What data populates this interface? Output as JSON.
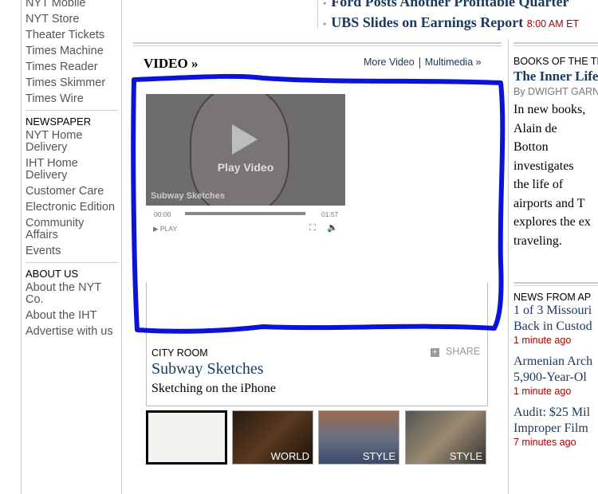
{
  "nav": {
    "items_top": [
      "NYT Mobile",
      "NYT Store",
      "Theater Tickets",
      "Times Machine",
      "Times Reader",
      "Times Skimmer",
      "Times Wire"
    ],
    "newspaper": {
      "heading": "NEWSPAPER",
      "items": [
        "NYT Home Delivery",
        "IHT Home Delivery",
        "Customer Care",
        "Electronic Edition",
        "Community Affairs",
        "Events"
      ]
    },
    "about": {
      "heading": "ABOUT US",
      "items": [
        "About the NYT Co.",
        "About the IHT",
        "Advertise with us"
      ]
    }
  },
  "headlines": [
    {
      "title": "Ford Posts Another Profitable Quarter",
      "time": ""
    },
    {
      "title": "UBS Slides on Earnings Report",
      "time": "8:00 AM ET"
    }
  ],
  "video": {
    "section_title": "VIDEO »",
    "more_video": "More Video",
    "multimedia": "Multimedia »",
    "player": {
      "play_label": "Play Video",
      "video_name": "Subway Sketches",
      "current_time": "00:00",
      "duration": "01:57",
      "play_button": "PLAY",
      "progress": 0
    },
    "category": "CITY ROOM",
    "share": "SHARE",
    "title": "Subway Sketches",
    "subtitle": "Sketching on the iPhone",
    "thumbs": [
      {
        "label": ""
      },
      {
        "label": "WORLD"
      },
      {
        "label": "STYLE"
      },
      {
        "label": "STYLE"
      }
    ]
  },
  "books": {
    "heading": "BOOKS OF THE TIMES",
    "title": "The Inner Life of Airports and",
    "byline": "By DWIGHT GARNER",
    "body": [
      "In new books,",
      "Alain de",
      "Botton",
      "investigates",
      "the life of",
      "airports and T",
      "explores the ex",
      "traveling."
    ]
  },
  "ap": {
    "heading": "NEWS FROM AP",
    "items": [
      {
        "title": [
          "1 of 3 Missouri",
          "Back in Custod"
        ],
        "time": "1 minute ago"
      },
      {
        "title": [
          "Armenian Arch",
          "5,900-Year-Ol"
        ],
        "time": "1 minute ago"
      },
      {
        "title": [
          "Audit: $25 Mil",
          "Improper Film"
        ],
        "time": "7 minutes ago"
      }
    ]
  },
  "colors": {
    "link": "#1a3a60",
    "time": "#aa0000",
    "annotation": "#0a14d8"
  }
}
